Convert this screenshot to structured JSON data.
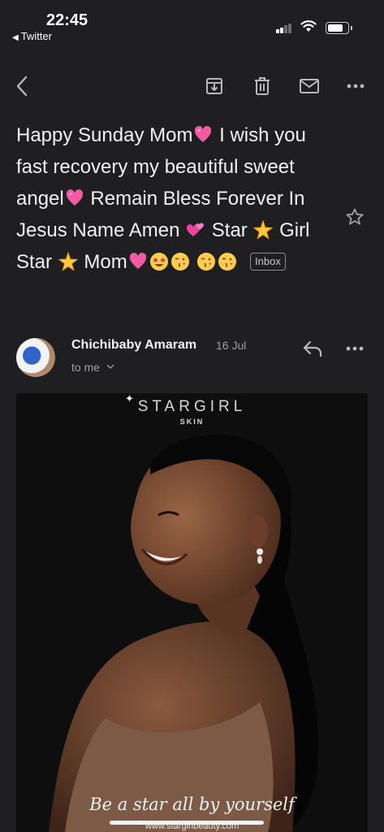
{
  "status_bar": {
    "time": "22:45",
    "back_app_label": "Twitter",
    "signal_bars_active": 2,
    "signal_bars_total": 4,
    "battery_level": 0.85
  },
  "toolbar": {
    "icons": [
      "back-chevron",
      "archive",
      "trash",
      "mark-unread",
      "more-horizontal"
    ]
  },
  "email": {
    "subject_parts": [
      "Happy Sunday Mom",
      "I wish you fast recovery my beautiful sweet angel",
      "Remain Bless Forever In Jesus Name Amen",
      "Star",
      "Girl Star",
      "Mom"
    ],
    "subject_emojis": [
      "pink-heart",
      "pink-heart",
      "two-hearts",
      "glowing-star",
      "glowing-star",
      "pink-heart",
      "star-struck",
      "face-blowing-kiss",
      "face-blowing-kiss",
      "face-blowing-kiss"
    ],
    "label_badge": "Inbox",
    "starred": false
  },
  "sender": {
    "name": "Chichibaby Amaram",
    "date": "16 Jul",
    "recipient_line": "to me"
  },
  "attachment_image": {
    "brand": "STARGIRL",
    "brand_sub": "SKIN",
    "tagline": "Be a star all by yourself",
    "website": "www.stargirlbeauty.com"
  },
  "colors": {
    "background": "#1f1f21",
    "text_primary": "#f1f1f3",
    "text_secondary": "#a0a0a4",
    "icon": "#b9b9bd"
  }
}
